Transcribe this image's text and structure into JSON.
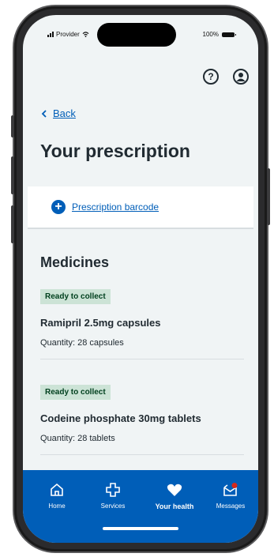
{
  "status_bar": {
    "carrier": "Provider",
    "battery": "100%"
  },
  "header": {
    "help_icon": "question-circle-icon",
    "profile_icon": "user-circle-icon"
  },
  "nav": {
    "back_label": "Back"
  },
  "page": {
    "title": "Your prescription"
  },
  "barcode": {
    "link_label": "Prescription barcode",
    "icon": "plus-circle-icon"
  },
  "medicines": {
    "heading": "Medicines",
    "items": [
      {
        "status": "Ready to collect",
        "name": "Ramipril 2.5mg capsules",
        "quantity": "Quantity: 28 capsules"
      },
      {
        "status": "Ready to collect",
        "name": "Codeine phosphate 30mg tablets",
        "quantity": "Quantity: 28 tablets"
      }
    ]
  },
  "tabbar": {
    "tabs": [
      {
        "label": "Home",
        "icon": "home-icon"
      },
      {
        "label": "Services",
        "icon": "services-cross-icon"
      },
      {
        "label": "Your health",
        "icon": "heart-icon",
        "active": true
      },
      {
        "label": "Messages",
        "icon": "messages-icon"
      }
    ]
  },
  "colors": {
    "primary": "#005eb8",
    "badge_bg": "#cce3d6",
    "badge_text": "#00401e",
    "text": "#212b32",
    "background": "#f0f4f5"
  }
}
